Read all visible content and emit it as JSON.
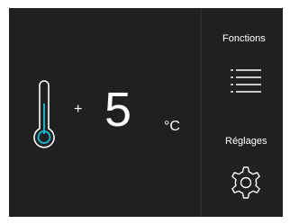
{
  "temperature": {
    "sign": "+",
    "value": "5",
    "unit": "°C"
  },
  "sidebar": {
    "functions_label": "Fonctions",
    "settings_label": "Réglages"
  },
  "icons": {
    "thermometer": "thermometer-icon",
    "menu": "menu-icon",
    "settings": "gear-icon"
  },
  "colors": {
    "background": "#1f2021",
    "text": "#ffffff",
    "accent": "#19b0c8"
  }
}
